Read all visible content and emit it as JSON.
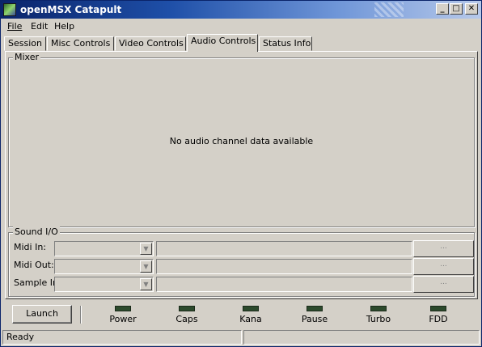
{
  "window": {
    "title": "openMSX Catapult"
  },
  "title_buttons": [
    "_",
    "□",
    "✕"
  ],
  "menu": [
    {
      "label": "File"
    },
    {
      "label": "Edit"
    },
    {
      "label": "Help"
    }
  ],
  "tabs": [
    {
      "label": "Session"
    },
    {
      "label": "Misc Controls"
    },
    {
      "label": "Video Controls"
    },
    {
      "label": "Audio Controls",
      "active": true
    },
    {
      "label": "Status Info"
    }
  ],
  "mixer": {
    "label": "Mixer",
    "message": "No audio channel data available"
  },
  "sound_io": {
    "label": "Sound I/O",
    "rows": [
      {
        "label": "Midi In:",
        "value": "",
        "button": "..."
      },
      {
        "label": "Midi Out:",
        "value": "",
        "button": "..."
      },
      {
        "label": "Sample In:",
        "value": "",
        "button": "..."
      }
    ]
  },
  "launch_label": "Launch",
  "indicators": [
    {
      "label": "Power"
    },
    {
      "label": "Caps"
    },
    {
      "label": "Kana"
    },
    {
      "label": "Pause"
    },
    {
      "label": "Turbo"
    },
    {
      "label": "FDD"
    }
  ],
  "status": {
    "text": "Ready"
  },
  "colors": {
    "title_dark": "#0a246a",
    "face": "#d4d0c8",
    "led_off": "#2c4a2c"
  }
}
